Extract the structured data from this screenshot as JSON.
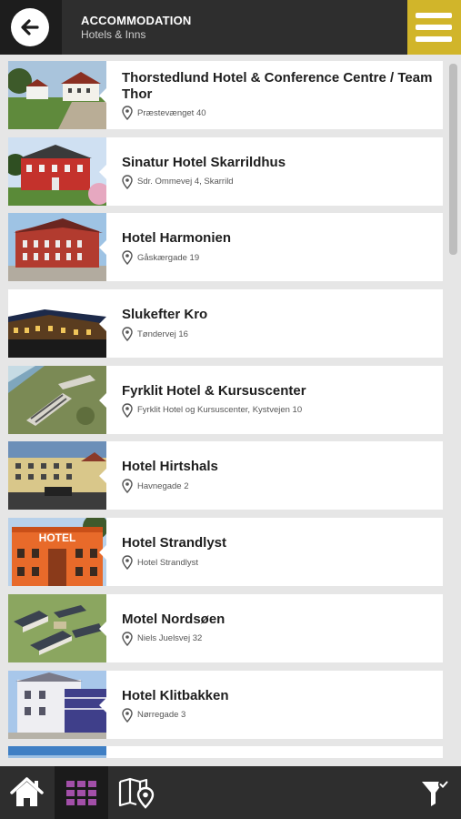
{
  "header": {
    "title": "ACCOMMODATION",
    "subtitle": "Hotels & Inns",
    "back_icon": "back-arrow-icon",
    "menu_icon": "hamburger-menu-icon",
    "menu_color": "#d1b52a"
  },
  "hotels": [
    {
      "name": "Thorstedlund Hotel & Conference Centre / Team Thor",
      "address": "Præstevænget 40"
    },
    {
      "name": "Sinatur Hotel Skarrildhus",
      "address": "Sdr. Ommevej 4, Skarrild"
    },
    {
      "name": "Hotel Harmonien",
      "address": "Gåskærgade 19"
    },
    {
      "name": "Slukefter Kro",
      "address": "Tøndervej 16"
    },
    {
      "name": "Fyrklit Hotel & Kursuscenter",
      "address": "Fyrklit Hotel og Kursuscenter, Kystvejen 10"
    },
    {
      "name": "Hotel Hirtshals",
      "address": "Havnegade 2"
    },
    {
      "name": "Hotel Strandlyst",
      "address": "Hotel Strandlyst"
    },
    {
      "name": "Motel Nordsøen",
      "address": "Niels Juelsvej 32"
    },
    {
      "name": "Hotel Klitbakken",
      "address": "Nørregade 3"
    },
    {
      "name": "",
      "address": ""
    }
  ],
  "thumb_signs": {
    "hotel_sign": "HOTEL"
  },
  "footer": {
    "icons": [
      "home-icon",
      "grid-view-icon",
      "map-icon",
      "filter-icon"
    ],
    "active_color": "#a24fa8"
  }
}
